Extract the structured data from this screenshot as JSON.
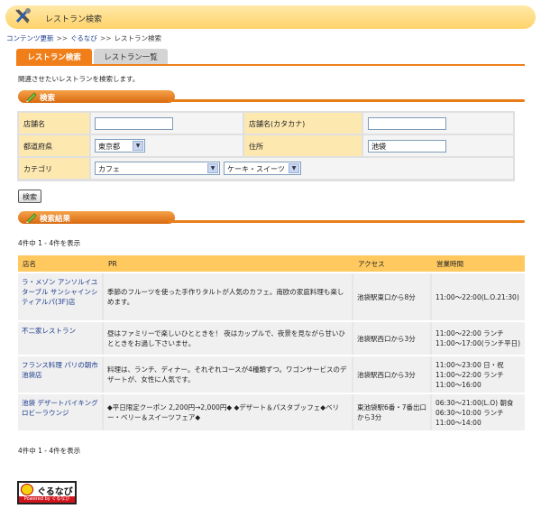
{
  "window": {
    "title": "レストラン検索",
    "icon": "tools-icon"
  },
  "breadcrumb": {
    "items": [
      "コンテンツ更新",
      "ぐるなび",
      "レストラン検索"
    ],
    "separator": ">>"
  },
  "tabs": [
    {
      "label": "レストラン検索",
      "active": true
    },
    {
      "label": "レストラン一覧",
      "active": false
    }
  ],
  "intro": "関連させたいレストランを検索します。",
  "search_section": {
    "title": "検索"
  },
  "form": {
    "name_label": "店舗名",
    "name_value": "",
    "kana_label": "店舗名(カタカナ)",
    "kana_value": "",
    "pref_label": "都道府県",
    "pref_value": "東京都",
    "address_label": "住所",
    "address_value": "池袋",
    "category_label": "カテゴリ",
    "category_value": "カフェ",
    "subcategory_value": "ケーキ・スイーツ"
  },
  "search_button": "検索",
  "results_section": {
    "title": "検索結果"
  },
  "count_top": "4件中 1 - 4件を表示",
  "count_bottom": "4件中 1 - 4件を表示",
  "table": {
    "headers": {
      "name": "店名",
      "pr": "PR",
      "access": "アクセス",
      "hours": "営業時間"
    },
    "rows": [
      {
        "name": "ラ・メゾン アンソルイユ ターブル サンシャインシティアルパ(3F)店",
        "pr": "季節のフルーツを使った手作りタルトが人気のカフェ。南欧の家庭料理も楽しめます。",
        "access": "池袋駅東口から8分",
        "hours": "11:00～22:00(L.O.21:30)"
      },
      {
        "name": "不二家レストラン",
        "pr": "昼はファミリーで楽しいひとときを！ 夜はカップルで、夜景を見ながら甘いひとときをお過し下さいませ。",
        "access": "池袋駅西口から3分",
        "hours": "11:00～22:00 ランチ 11:00～17:00(ランチ平日)"
      },
      {
        "name": "フランス料理 パリの朝市 池袋店",
        "pr": "料理は、ランチ、ディナー。それぞれコースが4種類ずつ。ワゴンサービスのデザートが、女性に人気です。",
        "access": "池袋駅西口から3分",
        "hours": "11:00～23:00 日・祝 11:00～22:00 ランチ 11:00～16:00"
      },
      {
        "name": "池袋 デザートバイキング ロビーラウンジ",
        "pr": "◆平日限定クーポン 2,200円→2,000円◆ ◆デザート＆パスタブッフェ◆ベリー・ベリー＆スイーツフェア◆",
        "access": "東池袋駅6番・7番出口から3分",
        "hours": "06:30～21:00(L.O) 朝食 06:30～10:00 ランチ 11:00～14:00"
      }
    ]
  },
  "logo": {
    "word": "ぐるなび",
    "tagline": "Powered by ぐるなび"
  },
  "colors": {
    "accent": "#f07f1a",
    "header_bg": "#ffd36a",
    "label_bg": "#fde8b0",
    "link": "#1a3a8c"
  }
}
